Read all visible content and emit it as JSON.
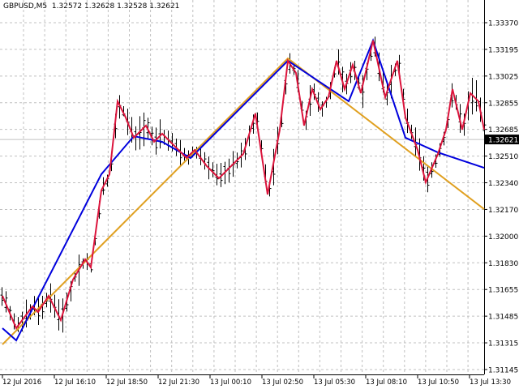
{
  "chart_data": {
    "type": "line",
    "title": "GBPUSD,M5",
    "ohlc_header": [
      "1.32572",
      "1.32628",
      "1.32528",
      "1.32621"
    ],
    "current_price": 1.32621,
    "current_price_label": "1.32621",
    "ylim": [
      1.3108,
      1.3348
    ],
    "y_ticks": [
      "1.33370",
      "1.33195",
      "1.33025",
      "1.32855",
      "1.32685",
      "1.32510",
      "1.32340",
      "1.32170",
      "1.32000",
      "1.31830",
      "1.31655",
      "1.31485",
      "1.31315",
      "1.31145"
    ],
    "x_ticks": [
      "12 Jul 2016",
      "12 Jul 16:10",
      "12 Jul 18:50",
      "12 Jul 21:30",
      "13 Jul 00:10",
      "13 Jul 02:50",
      "13 Jul 05:30",
      "13 Jul 08:10",
      "13 Jul 10:50",
      "13 Jul 13:30"
    ],
    "x_range_bars": [
      0,
      120
    ],
    "grid": true,
    "colors": {
      "bars": "#000000",
      "zigzag": "#dc143c",
      "blue": "#0000dd",
      "orange": "#e0a020",
      "grid": "#c0c0c0",
      "price_line": "#c0c0c0"
    },
    "series": [
      {
        "name": "zigzag",
        "points": [
          [
            0.6,
            1.31618
          ],
          [
            4,
            1.3141
          ],
          [
            8,
            1.3155
          ],
          [
            9.4,
            1.31514
          ],
          [
            12,
            1.31618
          ],
          [
            15,
            1.31462
          ],
          [
            18,
            1.31722
          ],
          [
            21,
            1.31852
          ],
          [
            22.4,
            1.318
          ],
          [
            25,
            1.32294
          ],
          [
            27,
            1.32398
          ],
          [
            29,
            1.32866
          ],
          [
            31,
            1.32762
          ],
          [
            33,
            1.32632
          ],
          [
            36,
            1.3271
          ],
          [
            38,
            1.32606
          ],
          [
            40,
            1.32658
          ],
          [
            43,
            1.3258
          ],
          [
            46,
            1.32502
          ],
          [
            48,
            1.32554
          ],
          [
            51,
            1.3245
          ],
          [
            54,
            1.32372
          ],
          [
            57,
            1.3245
          ],
          [
            60,
            1.32528
          ],
          [
            63,
            1.32788
          ],
          [
            66,
            1.32268
          ],
          [
            69,
            1.32684
          ],
          [
            71,
            1.33126
          ],
          [
            73,
            1.33048
          ],
          [
            75,
            1.3271
          ],
          [
            77,
            1.32944
          ],
          [
            79,
            1.32814
          ],
          [
            81,
            1.32892
          ],
          [
            83,
            1.33126
          ],
          [
            85,
            1.32944
          ],
          [
            87,
            1.331
          ],
          [
            89,
            1.32918
          ],
          [
            92,
            1.33256
          ],
          [
            95,
            1.32892
          ],
          [
            98,
            1.33126
          ],
          [
            100,
            1.32762
          ],
          [
            103,
            1.32554
          ],
          [
            105,
            1.32346
          ],
          [
            108,
            1.32528
          ],
          [
            110,
            1.32684
          ],
          [
            111.6,
            1.32944
          ],
          [
            114,
            1.32684
          ],
          [
            116,
            1.32918
          ],
          [
            118,
            1.32866
          ],
          [
            119.4,
            1.32684
          ]
        ]
      },
      {
        "name": "blue",
        "points": [
          [
            0.6,
            1.3141
          ],
          [
            4,
            1.31332
          ],
          [
            25,
            1.32398
          ],
          [
            33,
            1.32642
          ],
          [
            40,
            1.32606
          ],
          [
            47,
            1.32502
          ],
          [
            71,
            1.33126
          ],
          [
            86,
            1.32866
          ],
          [
            92,
            1.33256
          ],
          [
            100,
            1.32632
          ],
          [
            108,
            1.32538
          ],
          [
            119.4,
            1.32439
          ]
        ]
      },
      {
        "name": "orange",
        "points": [
          [
            0.6,
            1.31306
          ],
          [
            71,
            1.33141
          ],
          [
            119.4,
            1.32174
          ]
        ]
      }
    ]
  }
}
